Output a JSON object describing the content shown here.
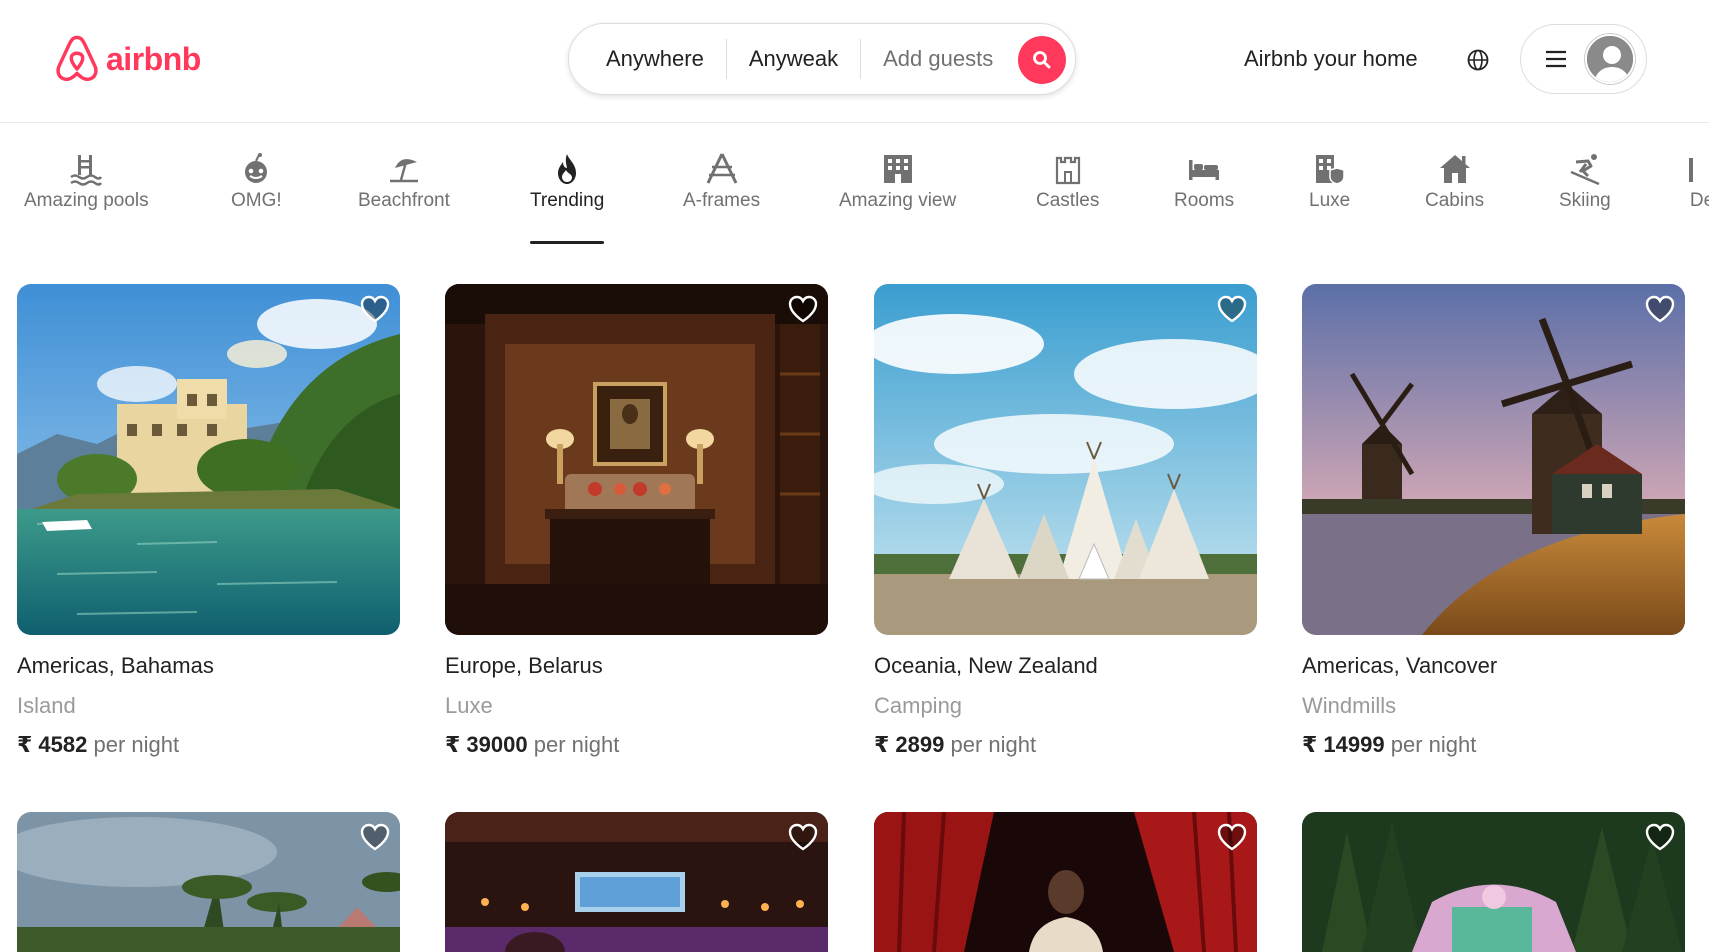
{
  "brand": {
    "name": "airbnb",
    "color": "#ff385c"
  },
  "search": {
    "where": "Anywhere",
    "when": "Anyweak",
    "guests": "Add guests",
    "button_icon": "search-icon"
  },
  "header": {
    "host_link": "Airbnb your home",
    "globe_icon": "globe-icon",
    "menu_icon": "hamburger-icon",
    "avatar_icon": "user-avatar-icon"
  },
  "categories": [
    {
      "label": "Amazing pools",
      "icon": "pool-icon"
    },
    {
      "label": "OMG!",
      "icon": "ufo-icon"
    },
    {
      "label": "Beachfront",
      "icon": "umbrella-icon"
    },
    {
      "label": "Trending",
      "icon": "flame-icon",
      "active": true
    },
    {
      "label": "A-frames",
      "icon": "a-frame-icon"
    },
    {
      "label": "Amazing view",
      "icon": "building-icon"
    },
    {
      "label": "Castles",
      "icon": "castle-icon"
    },
    {
      "label": "Rooms",
      "icon": "bed-icon"
    },
    {
      "label": "Luxe",
      "icon": "luxe-icon"
    },
    {
      "label": "Cabins",
      "icon": "cabin-icon"
    },
    {
      "label": "Skiing",
      "icon": "skier-icon"
    },
    {
      "label": "De",
      "icon": "design-icon"
    }
  ],
  "listings": [
    {
      "title": "Americas, Bahamas",
      "type": "Island",
      "price": "₹ 4582",
      "per": "per night"
    },
    {
      "title": "Europe, Belarus",
      "type": "Luxe",
      "price": "₹ 39000",
      "per": "per night"
    },
    {
      "title": "Oceania, New Zealand",
      "type": "Camping",
      "price": "₹ 2899",
      "per": "per night"
    },
    {
      "title": "Americas, Vancover",
      "type": "Windmills",
      "price": "₹ 14999",
      "per": "per night"
    }
  ]
}
